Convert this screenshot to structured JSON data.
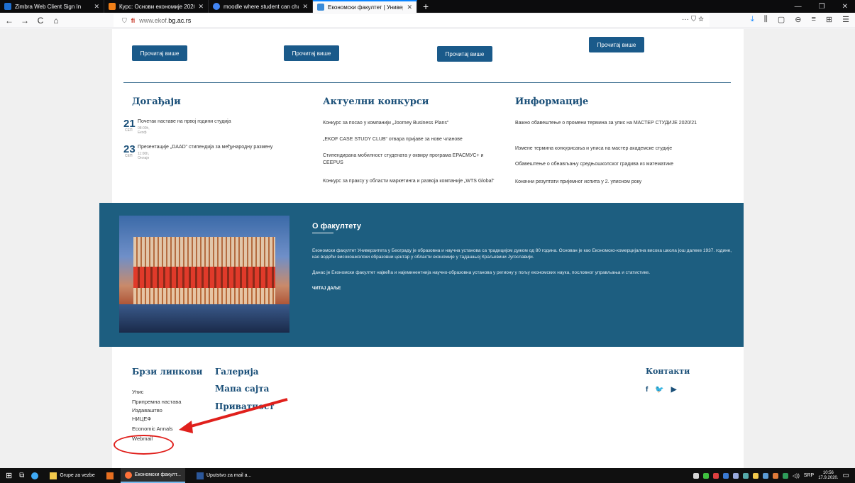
{
  "browser": {
    "tabs": [
      {
        "title": "Zimbra Web Client Sign In",
        "fav_color": "#1e6fd1"
      },
      {
        "title": "Курс: Основи економије 2020",
        "fav_color": "#f07f18"
      },
      {
        "title": "moodle where student can cha",
        "fav_color": "#4285f4"
      },
      {
        "title": "Економски факултет | Универ",
        "fav_color": "#3a8bd8",
        "active": true
      }
    ],
    "new_tab": "+",
    "url_prefix": "www.ekof.",
    "url_host": "bg.ac.rs",
    "url_menu": "··· ⛉ ☆",
    "nav": {
      "back": "←",
      "forward": "→",
      "reload": "C",
      "home": "⌂"
    },
    "window_controls": [
      "—",
      "❐",
      "✕"
    ],
    "toolbar_icons": [
      "⤓",
      "⫼",
      "▢",
      "⊖",
      "≡",
      "⊞",
      "☰"
    ]
  },
  "buttons": {
    "read_more_1": "Прочитај више",
    "read_more_2": "Прочитај више",
    "read_more_3": "Прочитај више",
    "read_more_4": "Прочитај више"
  },
  "events": {
    "heading": "Догађаји",
    "items": [
      {
        "day": "21",
        "month": "СЕП",
        "title": "Почетак наставе на првој години студија",
        "meta": "08:00h, Екоф"
      },
      {
        "day": "23",
        "month": "СЕП",
        "title": "Презентације „DAAD“ стипендија за међународну размену",
        "meta": "11:00h, Онлајн"
      }
    ]
  },
  "contests": {
    "heading": "Актуелни конкурси",
    "items": [
      "Конкурс за посао у компанији „Joorney Business Plans“",
      "„EKOF CASE STUDY CLUB“ отвара пријаве за нове чланове",
      "Стипендирана мобилност студената у оквиру програма ЕРАСМУС+ и CEEPUS",
      "Конкурс за праксу у области маркетинга и развоја компаније „WTS Global“"
    ]
  },
  "info": {
    "heading": "Информације",
    "items": [
      "Важно обавештење о промени термина за упис на МАСТЕР СТУДИЈЕ 2020/21",
      "Измене термина конкурисања и уписа на мастер академске студије",
      "Обавештење о обнављању средњошколског градива из математике",
      "Коначни резултати пријемног испита у 2. уписном року"
    ]
  },
  "about": {
    "heading": "О факултету",
    "p1": "Економски факултет Универзитета у Београду је образовна и научна установа са традицијом дужом од 80 година. Основан је као Економско-комерцијална висока школа још далеке 1937. године, као водећи високошколски образовни центар у области економије у тадашњој Краљевини Југославији.",
    "p2": "Данас је Економски факултет највећа и најеминентнија научно-образовна установа у региону у пољу економских наука, пословног управљања и статистике.",
    "more": "ЧИТАЈ ДАЉЕ"
  },
  "footer": {
    "quick_links_heading": "Брзи линкови",
    "links": [
      "Упис",
      "Припремна настава",
      "Издаваштво",
      "НИЦЕФ",
      "Economic Annals",
      "Webmail"
    ],
    "gallery": "Галерија",
    "sitemap": "Мапа сајта",
    "privacy": "Приватност",
    "contacts": "Контакти",
    "social": [
      "f",
      "🐦",
      "▶"
    ]
  },
  "taskbar": {
    "items": [
      "Grupe za vezbe",
      "Економски факулт...",
      "Uputstvo za mail a..."
    ],
    "lang": "SRP",
    "time": "10:56",
    "date": "17.9.2020."
  },
  "colors": {
    "brand": "#1a4f78",
    "accent_annotation": "#e0201c",
    "tab_active": "#0a84ff"
  }
}
